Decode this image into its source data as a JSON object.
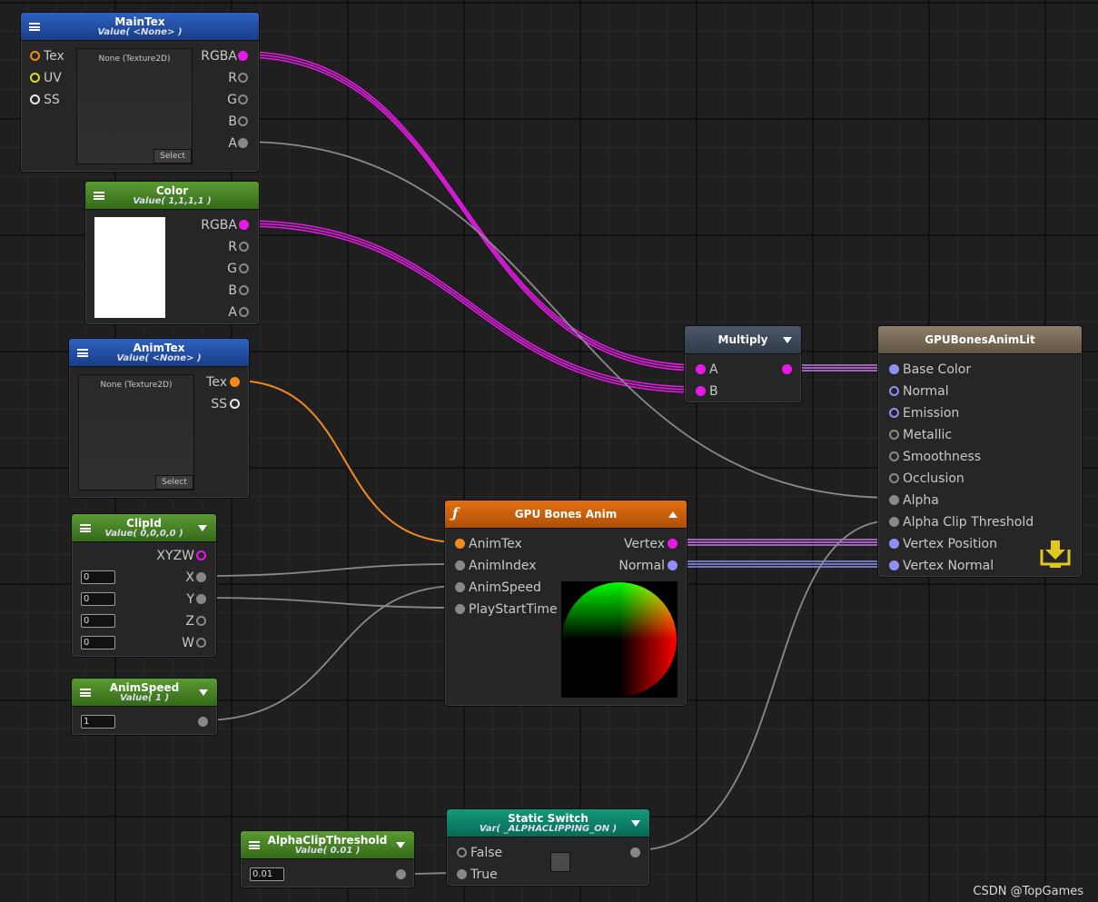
{
  "nodes": {
    "maintex": {
      "title": "MainTex",
      "subtitle": "Value( <None> )",
      "inputs": [
        "Tex",
        "UV",
        "SS"
      ],
      "outputs": [
        "RGBA",
        "R",
        "G",
        "B",
        "A"
      ],
      "preview": "None (Texture2D)",
      "select": "Select"
    },
    "color": {
      "title": "Color",
      "subtitle": "Value( 1,1,1,1 )",
      "outputs": [
        "RGBA",
        "R",
        "G",
        "B",
        "A"
      ],
      "swatch_color": "#ffffff"
    },
    "animtex": {
      "title": "AnimTex",
      "subtitle": "Value( <None> )",
      "outputs": [
        "Tex",
        "SS"
      ],
      "preview": "None (Texture2D)",
      "select": "Select"
    },
    "clipid": {
      "title": "ClipId",
      "subtitle": "Value( 0,0,0,0 )",
      "outputs": [
        "XYZW",
        "X",
        "Y",
        "Z",
        "W"
      ],
      "values": [
        "0",
        "0",
        "0",
        "0"
      ]
    },
    "animspeed": {
      "title": "AnimSpeed",
      "subtitle": "Value( 1 )",
      "value": "1"
    },
    "alphaclip": {
      "title": "AlphaClipThreshold",
      "subtitle": "Value( 0.01 )",
      "value": "0.01"
    },
    "multiply": {
      "title": "Multiply",
      "inputs": [
        "A",
        "B"
      ]
    },
    "gpubones": {
      "title": "GPU Bones Anim",
      "inputs": [
        "AnimTex",
        "AnimIndex",
        "AnimSpeed",
        "PlayStartTime"
      ],
      "outputs": [
        "Vertex",
        "Normal"
      ]
    },
    "staticswitch": {
      "title": "Static Switch",
      "subtitle": "Var( _ALPHACLIPPING_ON )",
      "inputs": [
        "False",
        "True"
      ]
    },
    "output": {
      "title": "GPUBonesAnimLit",
      "inputs": [
        "Base Color",
        "Normal",
        "Emission",
        "Metallic",
        "Smoothness",
        "Occlusion",
        "Alpha",
        "Alpha Clip Threshold",
        "Vertex Position",
        "Vertex Normal"
      ]
    }
  },
  "colors": {
    "magenta": "#e818e8",
    "orange": "#f48a1c",
    "gray_wire": "#8a8a8a",
    "vector_blue": "#8f8ff5",
    "save_icon": "#e0c81e"
  },
  "watermark": "CSDN @TopGames"
}
